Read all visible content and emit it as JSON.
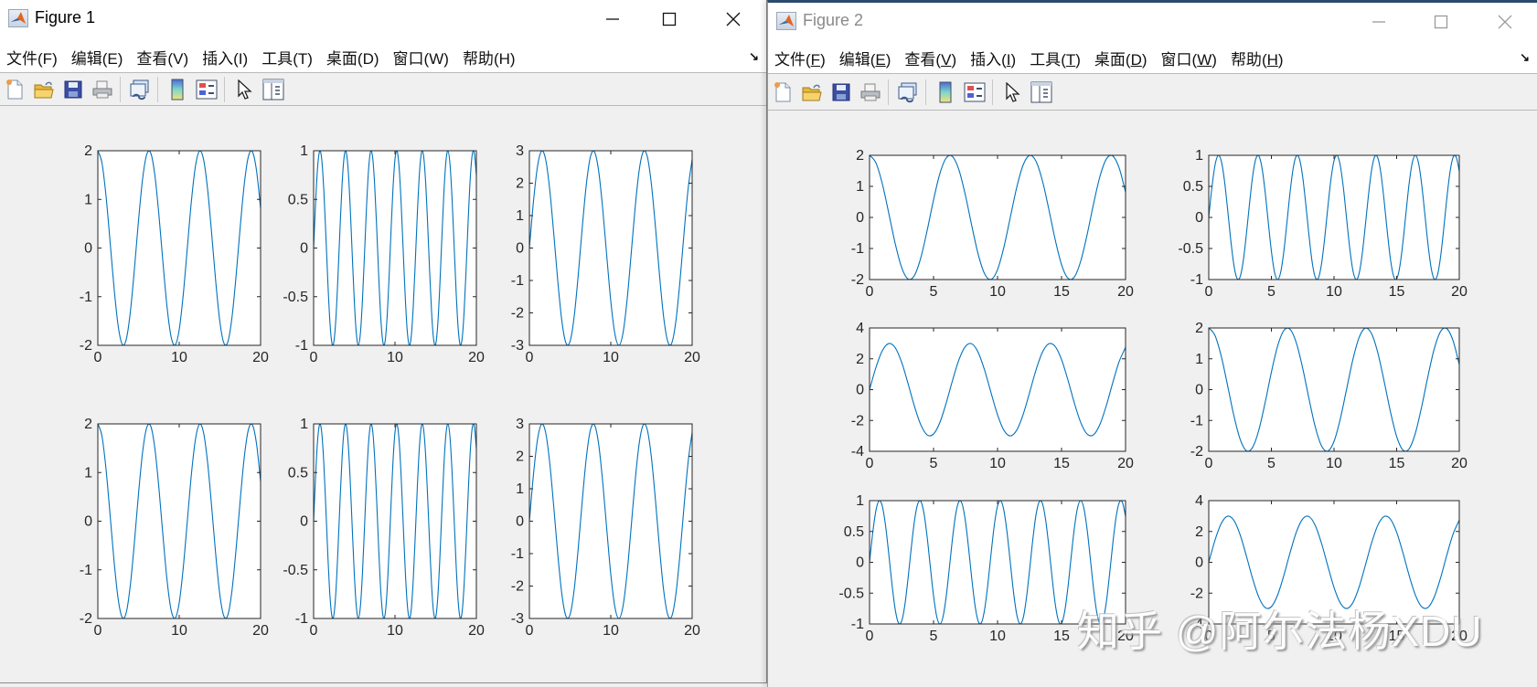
{
  "windows": [
    {
      "title": "Figure 1",
      "active": true,
      "menu": [
        {
          "label": "文件",
          "key": "F"
        },
        {
          "label": "编辑",
          "key": "E"
        },
        {
          "label": "查看",
          "key": "V"
        },
        {
          "label": "插入",
          "key": "I"
        },
        {
          "label": "工具",
          "key": "T"
        },
        {
          "label": "桌面",
          "key": "D"
        },
        {
          "label": "窗口",
          "key": "W"
        },
        {
          "label": "帮助",
          "key": "H"
        }
      ],
      "toolbar": [
        "new-figure-icon",
        "open-file-icon",
        "save-icon",
        "print-icon",
        "link-plot-icon",
        "insert-colorbar-icon",
        "insert-legend-icon",
        "edit-plot-pointer-icon",
        "property-inspector-icon"
      ]
    },
    {
      "title": "Figure 2",
      "active": false,
      "menu": [
        {
          "label": "文件",
          "key": "F"
        },
        {
          "label": "编辑",
          "key": "E"
        },
        {
          "label": "查看",
          "key": "V"
        },
        {
          "label": "插入",
          "key": "I"
        },
        {
          "label": "工具",
          "key": "T"
        },
        {
          "label": "桌面",
          "key": "D"
        },
        {
          "label": "窗口",
          "key": "W"
        },
        {
          "label": "帮助",
          "key": "H"
        }
      ],
      "toolbar": [
        "new-figure-icon",
        "open-file-icon",
        "save-icon",
        "print-icon",
        "link-plot-icon",
        "insert-colorbar-icon",
        "insert-legend-icon",
        "edit-plot-pointer-icon",
        "property-inspector-icon"
      ]
    }
  ],
  "watermark": "知乎 @阿尔法杨XDU",
  "colors": {
    "line": "#0072BD",
    "axes_bg": "#ffffff",
    "figure_bg": "#f0f0f0",
    "axis": "#262626"
  },
  "chart_data": {
    "series": {
      "s1": {
        "x": [
          0,
          0.5,
          1,
          1.5,
          2,
          2.5,
          3,
          3.5,
          4,
          4.5,
          5,
          5.5,
          6,
          6.5,
          7,
          7.5,
          8,
          8.5,
          9,
          9.5,
          10,
          10.5,
          11,
          11.5,
          12,
          12.5,
          13,
          13.5,
          14,
          14.5,
          15,
          15.5,
          16,
          16.5,
          17,
          17.5,
          18,
          18.5,
          19,
          19.5,
          20
        ],
        "y": [
          2,
          1.755,
          1.081,
          0.141,
          -0.832,
          -1.602,
          -1.98,
          -1.873,
          -1.307,
          -0.423,
          0.567,
          1.418,
          1.92,
          1.953,
          1.508,
          0.693,
          -0.291,
          -1.204,
          -1.822,
          -1.994,
          -1.678,
          -0.952,
          0.009,
          0.968,
          1.687,
          1.995,
          1.814,
          1.19,
          0.274,
          -0.709,
          -1.519,
          -1.957,
          -1.916,
          -1.405,
          -0.55,
          0.438,
          1.32,
          1.88,
          1.978,
          1.592,
          0.816
        ]
      },
      "s2": {
        "x": [
          0,
          0.25,
          0.5,
          0.75,
          1,
          1.25,
          1.5,
          1.75,
          2,
          2.25,
          2.5,
          2.75,
          3,
          3.25,
          3.5,
          3.75,
          4,
          4.25,
          4.5,
          4.75,
          5,
          5.25,
          5.5,
          5.75,
          6,
          6.25,
          6.5,
          6.75,
          7,
          7.25,
          7.5,
          7.75,
          8,
          8.25,
          8.5,
          8.75,
          9,
          9.25,
          9.5,
          9.75,
          10,
          10.25,
          10.5,
          10.75,
          11,
          11.25,
          11.5,
          11.75,
          12,
          12.25,
          12.5,
          12.75,
          13,
          13.25,
          13.5,
          13.75,
          14,
          14.25,
          14.5,
          14.75,
          15,
          15.25,
          15.5,
          15.75,
          16,
          16.25,
          16.5,
          16.75,
          17,
          17.25,
          17.5,
          17.75,
          18,
          18.25,
          18.5,
          18.75,
          19,
          19.25,
          19.5,
          19.75,
          20
        ],
        "y": [
          0,
          0.479,
          0.841,
          0.997,
          0.909,
          0.598,
          0.141,
          -0.351,
          -0.757,
          -0.978,
          -0.959,
          -0.706,
          -0.279,
          0.215,
          0.657,
          0.938,
          0.989,
          0.798,
          0.412,
          -0.075,
          -0.544,
          -0.88,
          -1,
          -0.875,
          -0.537,
          -0.066,
          0.42,
          0.804,
          0.991,
          0.935,
          0.65,
          0.207,
          -0.288,
          -0.712,
          -0.961,
          -0.976,
          -0.751,
          -0.343,
          0.15,
          0.605,
          0.913,
          0.997,
          0.837,
          0.472,
          -0.009,
          -0.487,
          -0.846,
          -0.998,
          -0.906,
          -0.591,
          -0.132,
          0.359,
          0.763,
          0.979,
          0.956,
          0.699,
          0.271,
          -0.224,
          -0.664,
          -0.941,
          -0.988,
          -0.793,
          -0.404,
          0.084,
          0.552,
          0.884,
          1,
          0.871,
          0.529,
          0.057,
          -0.428,
          -0.809,
          -0.992,
          -0.932,
          -0.644,
          -0.198,
          0.296,
          0.718,
          0.964,
          0.974,
          0.745
        ]
      },
      "s3": {
        "x": [
          0,
          0.5,
          1,
          1.5,
          2,
          2.5,
          3,
          3.5,
          4,
          4.5,
          5,
          5.5,
          6,
          6.5,
          7,
          7.5,
          8,
          8.5,
          9,
          9.5,
          10,
          10.5,
          11,
          11.5,
          12,
          12.5,
          13,
          13.5,
          14,
          14.5,
          15,
          15.5,
          16,
          16.5,
          17,
          17.5,
          18,
          18.5,
          19,
          19.5,
          20
        ],
        "y": [
          0,
          1.437,
          2.523,
          2.991,
          2.727,
          1.794,
          0.423,
          -1.053,
          -2.271,
          -2.934,
          -2.877,
          -2.118,
          -0.837,
          0.645,
          1.971,
          2.814,
          2.967,
          2.394,
          1.236,
          -0.225,
          -1.632,
          -2.64,
          -3,
          -2.625,
          -1.611,
          -0.198,
          1.26,
          2.412,
          2.973,
          2.805,
          1.95,
          0.621,
          -0.864,
          -2.136,
          -2.883,
          -2.928,
          -2.253,
          -1.029,
          0.45,
          1.815,
          2.739
        ]
      }
    },
    "charts": [
      {
        "figure": "Figure 1",
        "type": "line",
        "series": "s1",
        "xlim": [
          0,
          20
        ],
        "ylim": [
          -2,
          2
        ],
        "xticks": [
          0,
          10,
          20
        ],
        "yticks": [
          -2,
          -1,
          0,
          1,
          2
        ]
      },
      {
        "figure": "Figure 1",
        "type": "line",
        "series": "s2",
        "xlim": [
          0,
          20
        ],
        "ylim": [
          -1,
          1
        ],
        "xticks": [
          0,
          10,
          20
        ],
        "yticks": [
          -1,
          -0.5,
          0,
          0.5,
          1
        ]
      },
      {
        "figure": "Figure 1",
        "type": "line",
        "series": "s3",
        "xlim": [
          0,
          20
        ],
        "ylim": [
          -3,
          3
        ],
        "xticks": [
          0,
          10,
          20
        ],
        "yticks": [
          -3,
          -2,
          -1,
          0,
          1,
          2,
          3
        ]
      },
      {
        "figure": "Figure 1",
        "type": "line",
        "series": "s1",
        "xlim": [
          0,
          20
        ],
        "ylim": [
          -2,
          2
        ],
        "xticks": [
          0,
          10,
          20
        ],
        "yticks": [
          -2,
          -1,
          0,
          1,
          2
        ]
      },
      {
        "figure": "Figure 1",
        "type": "line",
        "series": "s2",
        "xlim": [
          0,
          20
        ],
        "ylim": [
          -1,
          1
        ],
        "xticks": [
          0,
          10,
          20
        ],
        "yticks": [
          -1,
          -0.5,
          0,
          0.5,
          1
        ]
      },
      {
        "figure": "Figure 1",
        "type": "line",
        "series": "s3",
        "xlim": [
          0,
          20
        ],
        "ylim": [
          -3,
          3
        ],
        "xticks": [
          0,
          10,
          20
        ],
        "yticks": [
          -3,
          -2,
          -1,
          0,
          1,
          2,
          3
        ]
      },
      {
        "figure": "Figure 2",
        "type": "line",
        "series": "s1",
        "xlim": [
          0,
          20
        ],
        "ylim": [
          -2,
          2
        ],
        "xticks": [
          0,
          5,
          10,
          15,
          20
        ],
        "yticks": [
          -2,
          -1,
          0,
          1,
          2
        ]
      },
      {
        "figure": "Figure 2",
        "type": "line",
        "series": "s2",
        "xlim": [
          0,
          20
        ],
        "ylim": [
          -1,
          1
        ],
        "xticks": [
          0,
          5,
          10,
          15,
          20
        ],
        "yticks": [
          -1,
          -0.5,
          0,
          0.5,
          1
        ]
      },
      {
        "figure": "Figure 2",
        "type": "line",
        "series": "s3",
        "xlim": [
          0,
          20
        ],
        "ylim": [
          -4,
          4
        ],
        "xticks": [
          0,
          5,
          10,
          15,
          20
        ],
        "yticks": [
          -4,
          -2,
          0,
          2,
          4
        ]
      },
      {
        "figure": "Figure 2",
        "type": "line",
        "series": "s1",
        "xlim": [
          0,
          20
        ],
        "ylim": [
          -2,
          2
        ],
        "xticks": [
          0,
          5,
          10,
          15,
          20
        ],
        "yticks": [
          -2,
          -1,
          0,
          1,
          2
        ]
      },
      {
        "figure": "Figure 2",
        "type": "line",
        "series": "s2",
        "xlim": [
          0,
          20
        ],
        "ylim": [
          -1,
          1
        ],
        "xticks": [
          0,
          5,
          10,
          15,
          20
        ],
        "yticks": [
          -1,
          -0.5,
          0,
          0.5,
          1
        ]
      },
      {
        "figure": "Figure 2",
        "type": "line",
        "series": "s3",
        "xlim": [
          0,
          20
        ],
        "ylim": [
          -4,
          4
        ],
        "xticks": [
          0,
          5,
          10,
          15,
          20
        ],
        "yticks": [
          -4,
          -2,
          0,
          2,
          4
        ]
      }
    ]
  }
}
